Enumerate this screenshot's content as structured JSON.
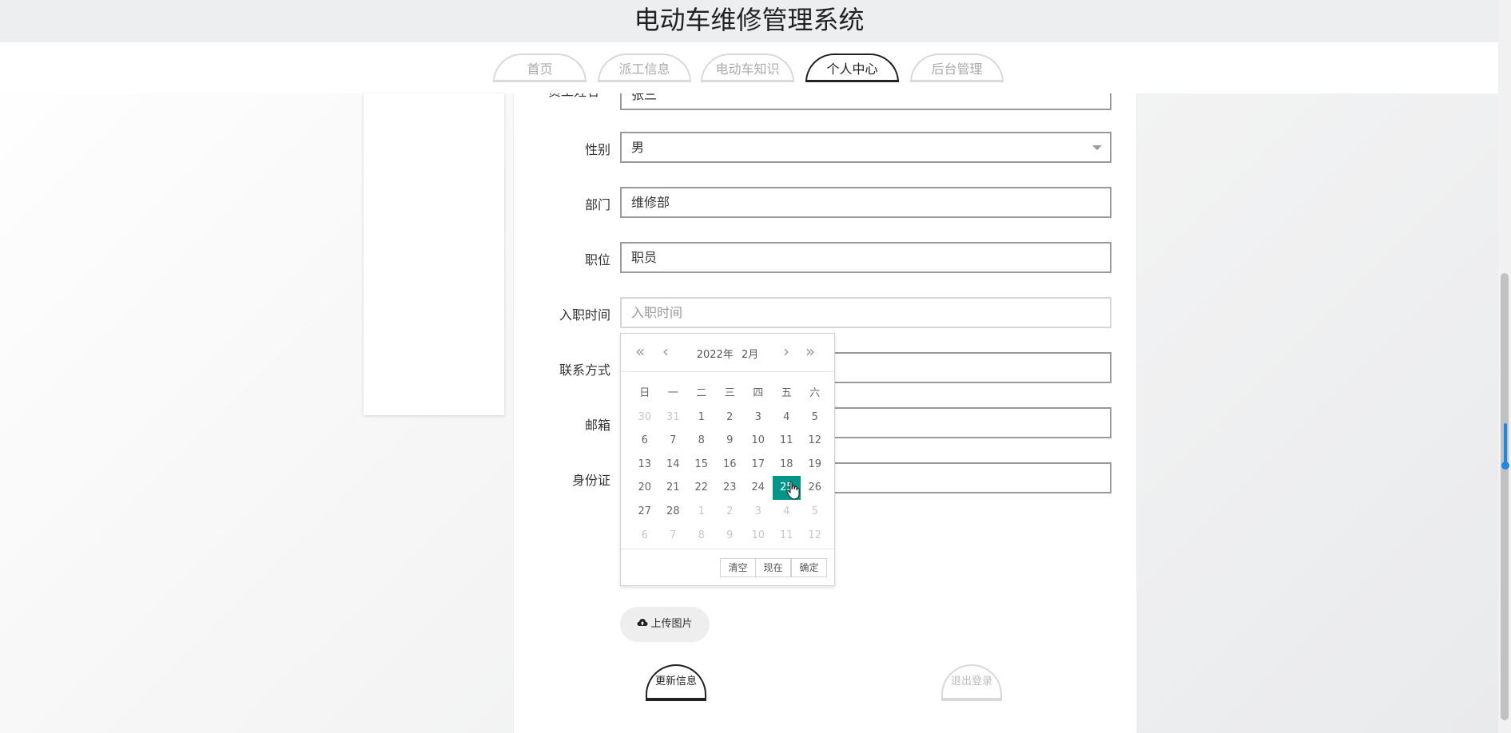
{
  "app": {
    "title": "电动车维修管理系统"
  },
  "nav": {
    "tabs": [
      {
        "label": "首页"
      },
      {
        "label": "派工信息"
      },
      {
        "label": "电动车知识"
      },
      {
        "label": "个人中心"
      },
      {
        "label": "后台管理"
      }
    ],
    "active": "个人中心"
  },
  "form": {
    "name_label_partial": "员工姓名",
    "name_value_partial": "张三",
    "gender_label": "性别",
    "gender_value": "男",
    "dept_label": "部门",
    "dept_value": "维修部",
    "position_label": "职位",
    "position_value": "职员",
    "hire_date_label": "入职时间",
    "hire_date_placeholder": "入职时间",
    "contact_label": "联系方式",
    "email_label": "邮箱",
    "id_card_label": "身份证"
  },
  "datepicker": {
    "year": "2022年",
    "month": "2月",
    "weekdays": [
      "日",
      "一",
      "二",
      "三",
      "四",
      "五",
      "六"
    ],
    "rows": [
      [
        "30",
        "31",
        "1",
        "2",
        "3",
        "4",
        "5"
      ],
      [
        "6",
        "7",
        "8",
        "9",
        "10",
        "11",
        "12"
      ],
      [
        "13",
        "14",
        "15",
        "16",
        "17",
        "18",
        "19"
      ],
      [
        "20",
        "21",
        "22",
        "23",
        "24",
        "25",
        "26"
      ],
      [
        "27",
        "28",
        "1",
        "2",
        "3",
        "4",
        "5"
      ],
      [
        "6",
        "7",
        "8",
        "9",
        "10",
        "11",
        "12"
      ]
    ],
    "selected": "25",
    "buttons": {
      "clear": "清空",
      "now": "现在",
      "confirm": "确定"
    }
  },
  "upload": {
    "label": "上传图片"
  },
  "actions": {
    "update": "更新信息",
    "logout": "退出登录"
  },
  "colors": {
    "accent": "#009688",
    "active_border": "#222222",
    "muted_border": "#d9d9d9"
  }
}
